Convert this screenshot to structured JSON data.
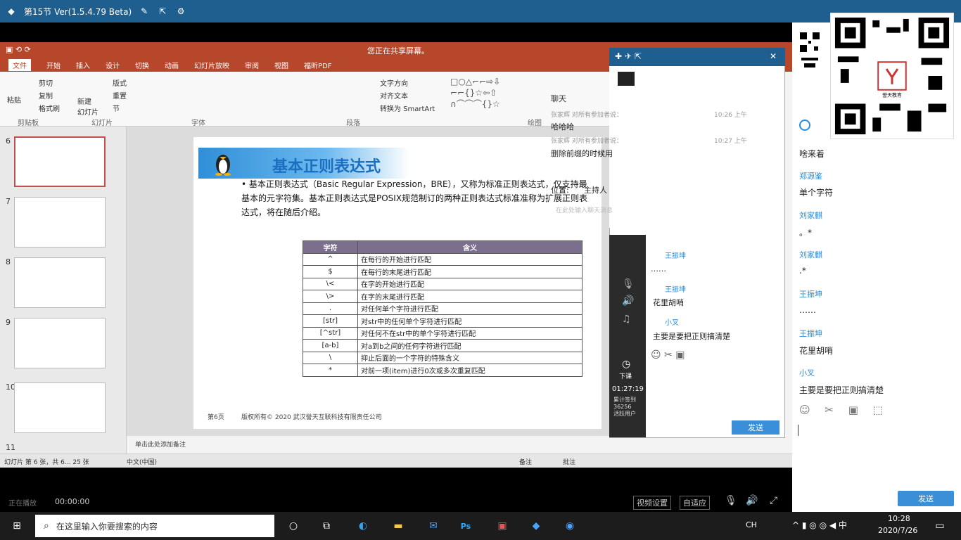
{
  "topbar": {
    "title": "第15节 Ver(1.5.4.79 Beta)"
  },
  "ppt": {
    "title_center": "您正在共享屏幕。",
    "menu": [
      "文件",
      "开始",
      "插入",
      "设计",
      "切换",
      "动画",
      "幻灯片放映",
      "审阅",
      "视图",
      "福昕PDF"
    ],
    "ribbon": {
      "cut": "剪切",
      "copy": "复制",
      "paste": "粘贴",
      "format_painter": "格式刷",
      "new_slide": "新建\n幻灯片",
      "layout": "版式",
      "reset": "重置",
      "section": "节",
      "clipboard": "剪贴板",
      "slides": "幻灯片",
      "font": "字体",
      "paragraph": "段落",
      "text_dir": "文字方向",
      "align_text": "对齐文本",
      "smartart": "转换为 SmartArt",
      "drawing": "绘图"
    },
    "thumb_nums": [
      "6",
      "7",
      "8",
      "9",
      "10",
      "11"
    ],
    "slide": {
      "title": "基本正则表达式",
      "para": "• 基本正则表达式（Basic Regular Expression，BRE），又称为标准正则表达式，仅支持最基本的元字符集。基本正则表达式是POSIX规范制订的两种正则表达式标准准称为扩展正则表达式，将在随后介绍。",
      "table_header": [
        "字符",
        "含义"
      ],
      "table_rows": [
        [
          "^",
          "在每行的开始进行匹配"
        ],
        [
          "$",
          "在每行的末尾进行匹配"
        ],
        [
          "\\<",
          "在字的开始进行匹配"
        ],
        [
          "\\>",
          "在字的末尾进行匹配"
        ],
        [
          ".",
          "对任何单个字符进行匹配"
        ],
        [
          "[str]",
          "对str中的任何单个字符进行匹配"
        ],
        [
          "[^str]",
          "对任何不在str中的单个字符进行匹配"
        ],
        [
          "[a-b]",
          "对a到b之间的任何字符进行匹配"
        ],
        [
          "\\",
          "抑止后面的一个字符的特殊含义"
        ],
        [
          "*",
          "对前一项(item)进行0次或多次重复匹配"
        ]
      ],
      "footer_page": "第6页",
      "footer_copy": "版权所有© 2020 武汉誉天互联科技有限责任公司"
    },
    "notes": "单击此处添加备注",
    "status_left": "幻灯片 第 6 张，共 6... 25 张",
    "status_lang": "中文(中国)",
    "status_notes": "备注",
    "status_comments": "批注"
  },
  "chat": {
    "header": "聊天",
    "msgs": [
      {
        "who": "张家辉 对所有参加者说：",
        "text": "哈哈哈",
        "time": "10:26 上午"
      },
      {
        "who": "张家辉 对所有参加者说：",
        "text": "删除前缀的时候用",
        "time": "10:27 上午"
      }
    ],
    "position_label": "位置:",
    "position_value": "主持人",
    "input_placeholder": "在此处输入聊天消息",
    "send": "发送",
    "side_names": [
      "王振坤",
      "王振坤",
      "小叉"
    ],
    "side_msgs": [
      "……",
      "花里胡哨",
      "主要是要把正则搞清楚"
    ],
    "timer": "01:27:19",
    "class_end": "下课",
    "counter": "累计签到\n36256\n活跃用户"
  },
  "right": {
    "msgs": [
      {
        "name": "",
        "text": "啥来着"
      },
      {
        "name": "郑源鉴",
        "text": "单个字符"
      },
      {
        "name": "刘家麒",
        "text": "。*"
      },
      {
        "name": "刘家麒",
        "text": ".*"
      },
      {
        "name": "王振坤",
        "text": "……"
      },
      {
        "name": "王振坤",
        "text": "花里胡哨"
      },
      {
        "name": "小叉",
        "text": "主要是要把正则搞清楚"
      }
    ],
    "send": "发送",
    "qr_label": "誉天教育"
  },
  "media": {
    "status": "正在播放",
    "time": "00:00:00",
    "video_settings": "视频设置",
    "adaptive": "自适应"
  },
  "taskbar": {
    "search": "在这里输入你要搜索的内容",
    "time": "10:28",
    "date": "2020/7/26",
    "lang": "CH"
  }
}
